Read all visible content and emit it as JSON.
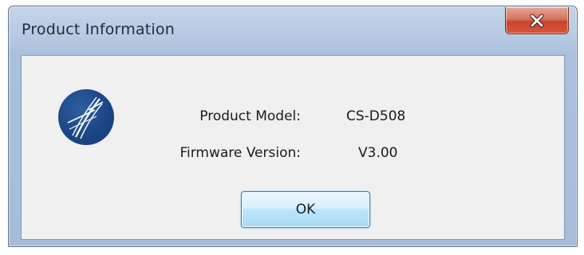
{
  "window": {
    "title": "Product Information"
  },
  "icons": {
    "close": "close-icon",
    "logo": "app-logo"
  },
  "info": {
    "model_label": "Product Model:",
    "model_value": "CS-D508",
    "firmware_label": "Firmware Version:",
    "firmware_value": "V3.00"
  },
  "buttons": {
    "ok_label": "OK"
  },
  "colors": {
    "close_button": "#c8452b",
    "logo": "#1b4686",
    "ok_border": "#3c7fb1"
  }
}
